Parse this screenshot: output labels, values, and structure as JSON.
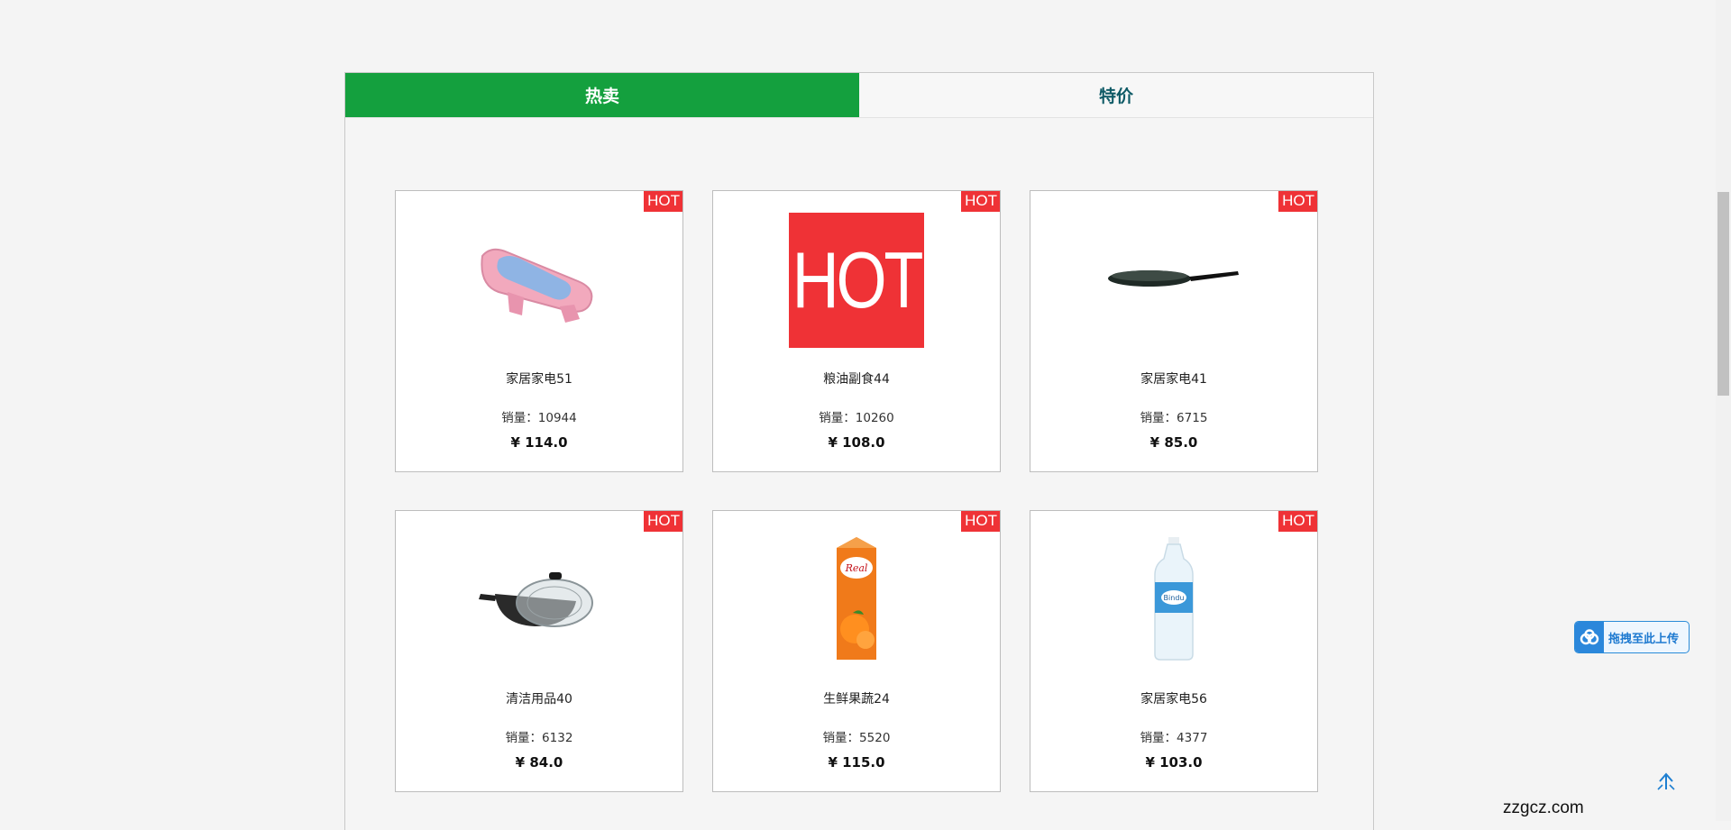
{
  "tabs": [
    {
      "label": "热卖",
      "active": true
    },
    {
      "label": "特价",
      "active": false
    }
  ],
  "badge": "HOT",
  "products": [
    {
      "name": "家居家电51",
      "sales_label": "销量：10944",
      "price": "¥ 114.0",
      "icon": "baby-bath-tub"
    },
    {
      "name": "粮油副食44",
      "sales_label": "销量：10260",
      "price": "¥ 108.0",
      "icon": "hot-placeholder"
    },
    {
      "name": "家居家电41",
      "sales_label": "销量：6715",
      "price": "¥ 85.0",
      "icon": "frying-pan"
    },
    {
      "name": "清洁用品40",
      "sales_label": "销量：6132",
      "price": "¥ 84.0",
      "icon": "wok-with-lid"
    },
    {
      "name": "生鲜果蔬24",
      "sales_label": "销量：5520",
      "price": "¥ 115.0",
      "icon": "orange-juice-carton"
    },
    {
      "name": "家居家电56",
      "sales_label": "销量：4377",
      "price": "¥ 103.0",
      "icon": "water-bottle"
    }
  ],
  "hot_placeholder_text": "HOT",
  "upload_button": {
    "label": "拖拽至此上传",
    "icon": "cloud-upload-icon"
  },
  "back_to_top": {
    "icon": "arrow-up-icon"
  },
  "watermark": "zzgcz.com",
  "colors": {
    "accent_green": "#14a03e",
    "hot_red": "#ef3236",
    "inactive_tab_text": "#0e5a66",
    "upload_blue": "#2b87db"
  }
}
